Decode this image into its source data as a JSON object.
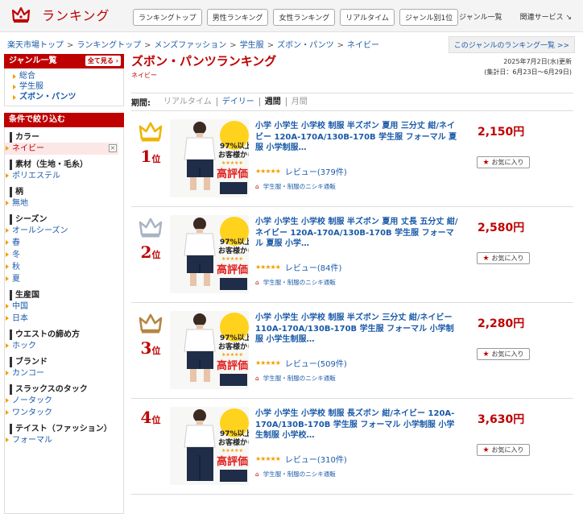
{
  "header": {
    "logo_text": "ランキング",
    "nav": [
      "ランキングトップ",
      "男性ランキング",
      "女性ランキング",
      "リアルタイム",
      "ジャンル別1位"
    ],
    "right": [
      "ジャンル一覧",
      "関連サービス ↘"
    ]
  },
  "breadcrumb": [
    "楽天市場トップ",
    "ランキングトップ",
    "メンズファッション",
    "学生服",
    "ズボン・パンツ",
    "ネイビー"
  ],
  "genre_ranking_link": "このジャンルのランキング一覧 >>",
  "sidebar": {
    "genre_title": "ジャンル一覧",
    "all_button": "全て見る",
    "genres": [
      "総合",
      "学生服",
      "ズボン・パンツ"
    ],
    "filter_title": "条件で絞り込む",
    "filters": [
      {
        "title": "カラー",
        "items": [
          "ネイビー"
        ]
      },
      {
        "title": "素材（生地・毛糸）",
        "items": [
          "ポリエステル"
        ]
      },
      {
        "title": "柄",
        "items": [
          "無地"
        ]
      },
      {
        "title": "シーズン",
        "items": [
          "オールシーズン",
          "春",
          "冬",
          "秋",
          "夏"
        ]
      },
      {
        "title": "生産国",
        "items": [
          "中国",
          "日本"
        ]
      },
      {
        "title": "ウエストの締め方",
        "items": [
          "ホック"
        ]
      },
      {
        "title": "ブランド",
        "items": [
          "カンコー"
        ]
      },
      {
        "title": "スラックスのタック",
        "items": [
          "ノータック",
          "ワンタック"
        ]
      },
      {
        "title": "テイスト（ファッション）",
        "items": [
          "フォーマル"
        ]
      }
    ]
  },
  "main": {
    "title": "ズボン・パンツランキング",
    "subtitle": "ネイビー",
    "updated": "2025年7月2日(水)更新",
    "period_range": "(集計日：6月23日〜6月29日)",
    "period_label": "期間:",
    "periods": [
      "リアルタイム",
      "デイリー",
      "週間",
      "月間"
    ],
    "rank_suffix": "位",
    "fav_label": "お気に入り",
    "thumb_badge": {
      "line1": "97%以上の",
      "line2": "お客様から",
      "line3": "高評価"
    },
    "items": [
      {
        "rank": "1",
        "name": "小学 小学生 小学校 制服 半ズボン 夏用 三分丈 紺/ネイビー 120A-170A/130B-170B 学生服 フォーマル 夏服 小学制服…",
        "price": "2,150円",
        "review": "レビュー(379件)",
        "shop": "学生服・制服のニシキ通販"
      },
      {
        "rank": "2",
        "name": "小学 小学生 小学校 制服 半ズボン 夏用 丈長 五分丈 紺/ネイビー 120A-170A/130B-170B 学生服 フォーマル 夏服 小学…",
        "price": "2,580円",
        "review": "レビュー(84件)",
        "shop": "学生服・制服のニシキ通販"
      },
      {
        "rank": "3",
        "name": "小学 小学生 小学校 制服 半ズボン 三分丈 紺/ネイビー 110A-170A/130B-170B 学生服 フォーマル 小学制服 小学生制服…",
        "price": "2,280円",
        "review": "レビュー(509件)",
        "shop": "学生服・制服のニシキ通販"
      },
      {
        "rank": "4",
        "name": "小学 小学生 小学校 制服 長ズボン 紺/ネイビー 120A-170A/130B-170B 学生服 フォーマル 小学制服 小学生制服 小学校…",
        "price": "3,630円",
        "review": "レビュー(310件)",
        "shop": "学生服・制服のニシキ通販"
      }
    ]
  },
  "colors": {
    "accent": "#bf0000",
    "link": "#1a5aa8",
    "gold": "#f0a000"
  }
}
